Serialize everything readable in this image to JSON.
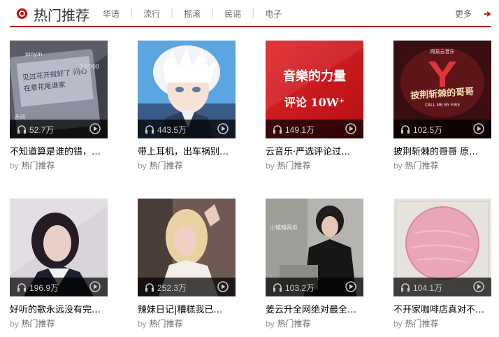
{
  "header": {
    "title": "热门推荐",
    "tabs": [
      "华语",
      "流行",
      "摇滚",
      "民谣",
      "电子"
    ],
    "separator": "|",
    "more_label": "更多"
  },
  "colors": {
    "accent": "#c10d0c"
  },
  "playlists": [
    {
      "title": "不知道算是谁的错，…",
      "play_count": "52.7万",
      "by_prefix": "by",
      "author": "热门推荐",
      "cover_text": [
        "见过花开就好了 问心",
        "在意花尾谁家",
        "17/900",
        "pinyin",
        "选词"
      ]
    },
    {
      "title": "带上耳机，出车祸别…",
      "play_count": "443.5万",
      "by_prefix": "by",
      "author": "热门推荐",
      "cover_text": []
    },
    {
      "title": "云音乐·严选评论过…",
      "play_count": "149.1万",
      "by_prefix": "by",
      "author": "热门推荐",
      "cover_text": [
        "音樂的力量",
        "评论 10W⁺"
      ]
    },
    {
      "title": "披荆斩棘的哥哥 原…",
      "play_count": "102.5万",
      "by_prefix": "by",
      "author": "热门推荐",
      "cover_text": [
        "网易云音乐",
        "披荆斩棘的哥哥",
        "CALL ME BY FIRE"
      ]
    },
    {
      "title": "好听的歌永远没有完…",
      "play_count": "196.9万",
      "by_prefix": "by",
      "author": "热门推荐",
      "cover_text": []
    },
    {
      "title": "辣妹日记|糟糕我已…",
      "play_count": "252.3万",
      "by_prefix": "by",
      "author": "热门推荐",
      "cover_text": []
    },
    {
      "title": "姜云升全网绝对最全…",
      "play_count": "103.2万",
      "by_prefix": "by",
      "author": "热门推荐",
      "cover_text": [
        "小城暗雨瓜"
      ]
    },
    {
      "title": "不开家咖啡店真对不…",
      "play_count": "104.1万",
      "by_prefix": "by",
      "author": "热门推荐",
      "cover_text": []
    }
  ]
}
